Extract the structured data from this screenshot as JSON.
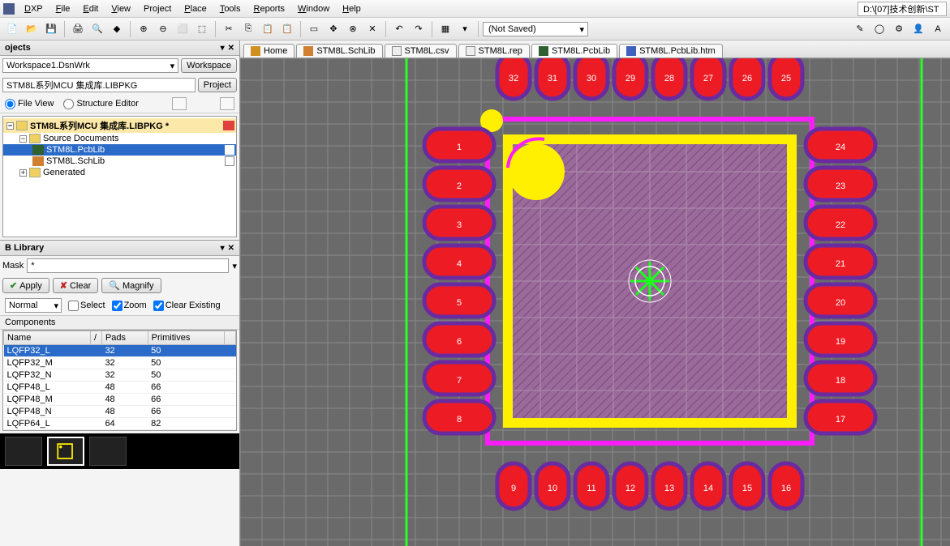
{
  "menu": {
    "items": [
      "DXP",
      "File",
      "Edit",
      "View",
      "Project",
      "Place",
      "Tools",
      "Reports",
      "Window",
      "Help"
    ],
    "path": "D:\\[07]技术创新\\ST"
  },
  "toolbar_combo": "(Not Saved)",
  "projects_panel": {
    "title": "ojects",
    "workspace": "Workspace1.DsnWrk",
    "workspace_btn": "Workspace",
    "project_name": "STM8L系列MCU 集成库.LIBPKG",
    "project_btn": "Project",
    "radio_fileview": "File View",
    "radio_structure": "Structure Editor",
    "tree": {
      "root": "STM8L系列MCU 集成库.LIBPKG *",
      "src_docs": "Source Documents",
      "pcblib": "STM8L.PcbLib",
      "schlib": "STM8L.SchLib",
      "generated": "Generated"
    }
  },
  "library_panel": {
    "title": "B Library",
    "mask_label": "Mask",
    "mask_value": "*",
    "apply": "Apply",
    "clear": "Clear",
    "magnify": "Magnify",
    "normal": "Normal",
    "select": "Select",
    "zoom": "Zoom",
    "clear_existing": "Clear Existing",
    "components": "Components",
    "cols": [
      "Name",
      "Pads",
      "Primitives"
    ],
    "rows": [
      {
        "name": "LQFP32_L",
        "pads": "32",
        "prim": "50"
      },
      {
        "name": "LQFP32_M",
        "pads": "32",
        "prim": "50"
      },
      {
        "name": "LQFP32_N",
        "pads": "32",
        "prim": "50"
      },
      {
        "name": "LQFP48_L",
        "pads": "48",
        "prim": "66"
      },
      {
        "name": "LQFP48_M",
        "pads": "48",
        "prim": "66"
      },
      {
        "name": "LQFP48_N",
        "pads": "48",
        "prim": "66"
      },
      {
        "name": "LQFP64_L",
        "pads": "64",
        "prim": "82"
      }
    ]
  },
  "doc_tabs": [
    {
      "label": "Home",
      "type": "home"
    },
    {
      "label": "STM8L.SchLib",
      "type": "sch"
    },
    {
      "label": "STM8L.csv",
      "type": "txt"
    },
    {
      "label": "STM8L.rep",
      "type": "txt"
    },
    {
      "label": "STM8L.PcbLib",
      "type": "pcb",
      "active": true
    },
    {
      "label": "STM8L.PcbLib.htm",
      "type": "htm"
    }
  ],
  "footprint": {
    "pads_left": [
      "1",
      "2",
      "3",
      "4",
      "5",
      "6",
      "7",
      "8"
    ],
    "pads_right": [
      "24",
      "23",
      "22",
      "21",
      "20",
      "19",
      "18",
      "17"
    ],
    "pads_top": [
      "32",
      "31",
      "30",
      "29",
      "28",
      "27",
      "26",
      "25"
    ],
    "pads_bottom": [
      "9",
      "10",
      "11",
      "12",
      "13",
      "14",
      "15",
      "16"
    ]
  },
  "colors": {
    "pad_fill": "#ed1c24",
    "pad_stroke": "#6a2aa0",
    "overlay": "#ffef00",
    "courtyard": "#ff1cff",
    "body": "#9a6a9a"
  }
}
